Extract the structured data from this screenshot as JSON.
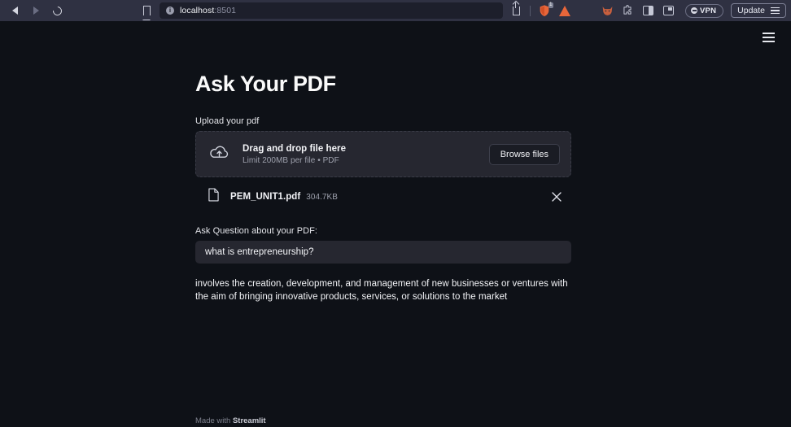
{
  "browser": {
    "nav": {
      "back": "back-navigation",
      "forward": "forward-navigation",
      "reload": "reload-page",
      "bookmark": "bookmark-page"
    },
    "url": {
      "host": "localhost",
      "port": ":8501",
      "security_icon": "info-circle-icon",
      "value": "localhost:8501"
    },
    "actions": {
      "share": "share-icon",
      "brave_shields": "brave-shields-icon",
      "brave_shields_count": "1",
      "cone": "cone-icon"
    },
    "extensions": [
      {
        "name": "fox-icon"
      },
      {
        "name": "puzzle-icon"
      },
      {
        "name": "side-panel-icon"
      },
      {
        "name": "split-view-icon"
      }
    ],
    "vpn": {
      "label": "VPN"
    },
    "update": {
      "label": "Update"
    }
  },
  "app": {
    "menu_icon": "hamburger-menu-icon",
    "title": "Ask Your PDF",
    "upload_label": "Upload your pdf",
    "uploader": {
      "cloud_icon": "cloud-upload-icon",
      "drag_text": "Drag and drop file here",
      "limit_text": "Limit 200MB per file • PDF",
      "browse_label": "Browse files"
    },
    "uploaded_file": {
      "doc_icon": "document-icon",
      "name": "PEM_UNIT1.pdf",
      "size": "304.7KB",
      "remove_icon": "close-icon"
    },
    "question": {
      "label": "Ask Question about your PDF:",
      "value": "what is entrepreneurship?",
      "placeholder": ""
    },
    "answer": "involves the creation, development, and management of new businesses or ventures with the aim of bringing innovative products, services, or solutions to the market",
    "footer": {
      "prefix": "Made with ",
      "brand": "Streamlit"
    }
  },
  "colors": {
    "app_background": "#0e1117",
    "secondary_background": "#262730",
    "chrome_background": "#2f3142",
    "text_primary": "#fafafa",
    "text_muted": "#9ea1ad",
    "brave_orange": "#e8663a",
    "progress_red": "#c0392b",
    "progress_gold": "#cfa23f"
  }
}
